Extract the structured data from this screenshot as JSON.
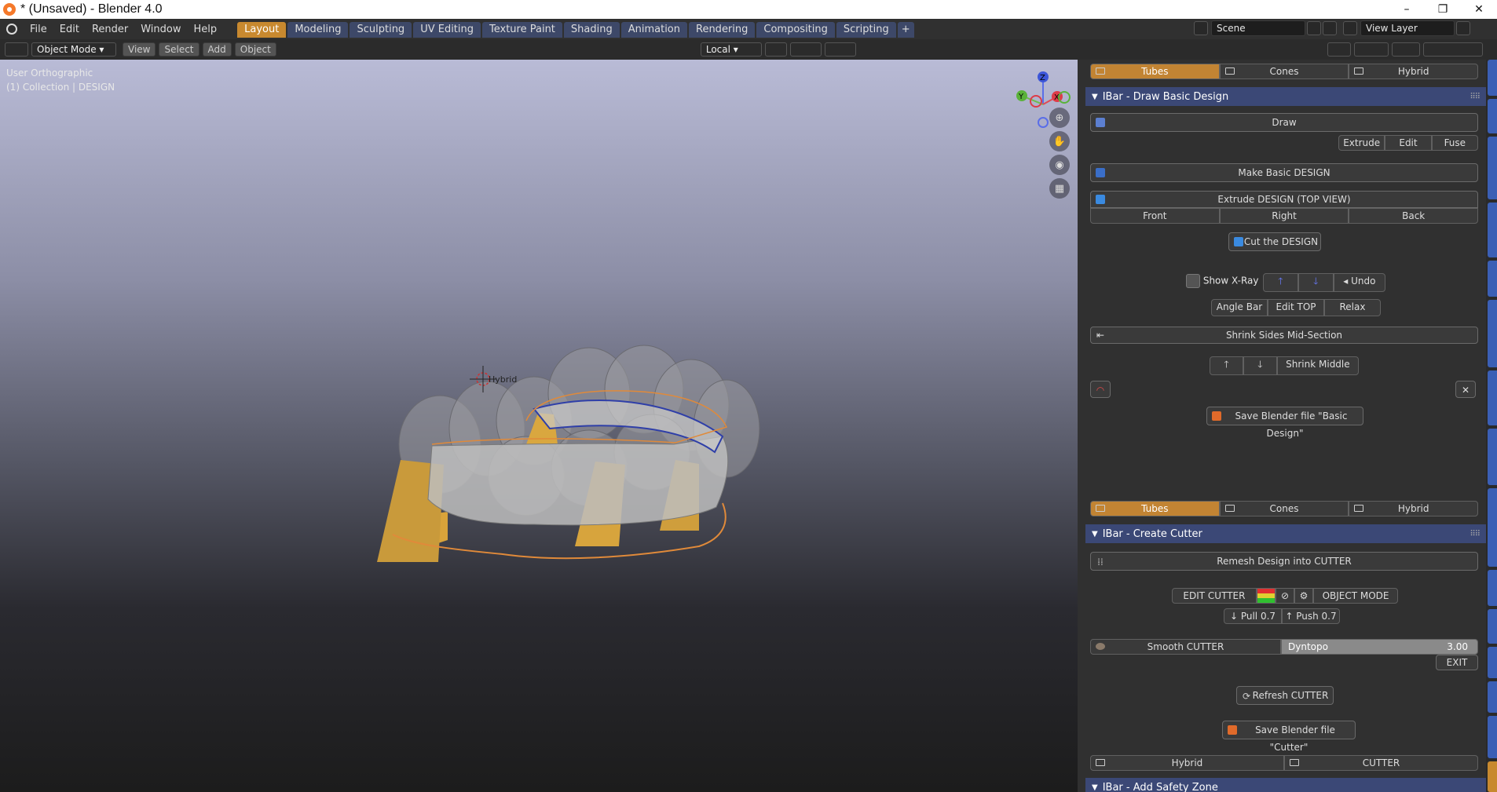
{
  "window": {
    "title": "* (Unsaved) - Blender 4.0",
    "minimize": "–",
    "maximize": "❐",
    "close": "✕"
  },
  "menu": [
    "File",
    "Edit",
    "Render",
    "Window",
    "Help"
  ],
  "workspaces": [
    "Layout",
    "Modeling",
    "Sculpting",
    "UV Editing",
    "Texture Paint",
    "Shading",
    "Animation",
    "Rendering",
    "Compositing",
    "Scripting",
    "+"
  ],
  "scene": {
    "name": "Scene",
    "view_layer": "View Layer"
  },
  "header": {
    "mode": "Object Mode",
    "view": "View",
    "select": "Select",
    "add": "Add",
    "object": "Object",
    "transform": "Local"
  },
  "viewport": {
    "projection": "User Orthographic",
    "collection": "(1) Collection | DESIGN",
    "cursor_label": "Hybrid",
    "axes": {
      "z": "Z",
      "y": "Y",
      "x": "X"
    }
  },
  "panel": {
    "top_tabs": [
      "Tubes",
      "Cones",
      "Hybrid"
    ],
    "draw_title": "IBar - Draw Basic Design",
    "draw": "Draw",
    "draw_row": [
      "Extrude",
      "Edit",
      "Fuse"
    ],
    "make": "Make  Basic DESIGN",
    "extrude": "Extrude  DESIGN (TOP VIEW)",
    "views": [
      "Front",
      "Right",
      "Back"
    ],
    "cut": "Cut the DESIGN",
    "xray": "Show X-Ray",
    "undo": "Undo",
    "row2": [
      "Angle Bar",
      "Edit TOP",
      "Relax"
    ],
    "shrink_sides": "Shrink Sides Mid-Section",
    "shrink_middle": "Shrink Middle",
    "save_basic": "Save Blender file \"Basic Design\"",
    "mid_tabs": [
      "Tubes",
      "Cones",
      "Hybrid"
    ],
    "cutter_title": "IBar - Create Cutter",
    "remesh": "Remesh Design into CUTTER",
    "edit_cutter": "EDIT CUTTER",
    "object_mode": "OBJECT MODE",
    "pull": "Pull 0.7",
    "push": "Push 0.7",
    "smooth": "Smooth CUTTER",
    "dyntopo": "Dyntopo",
    "dyntopo_val": "3.00",
    "exit": "EXIT",
    "refresh": "Refresh CUTTER",
    "save_cutter": "Save Blender file \"Cutter\"",
    "bottom_tabs": [
      "Hybrid",
      "CUTTER"
    ],
    "safety_title": "IBar - Add Safety Zone"
  },
  "colors": {
    "accent": "#c8892f",
    "tab_blue": "#3d4868",
    "panel_header": "#3b4876"
  }
}
